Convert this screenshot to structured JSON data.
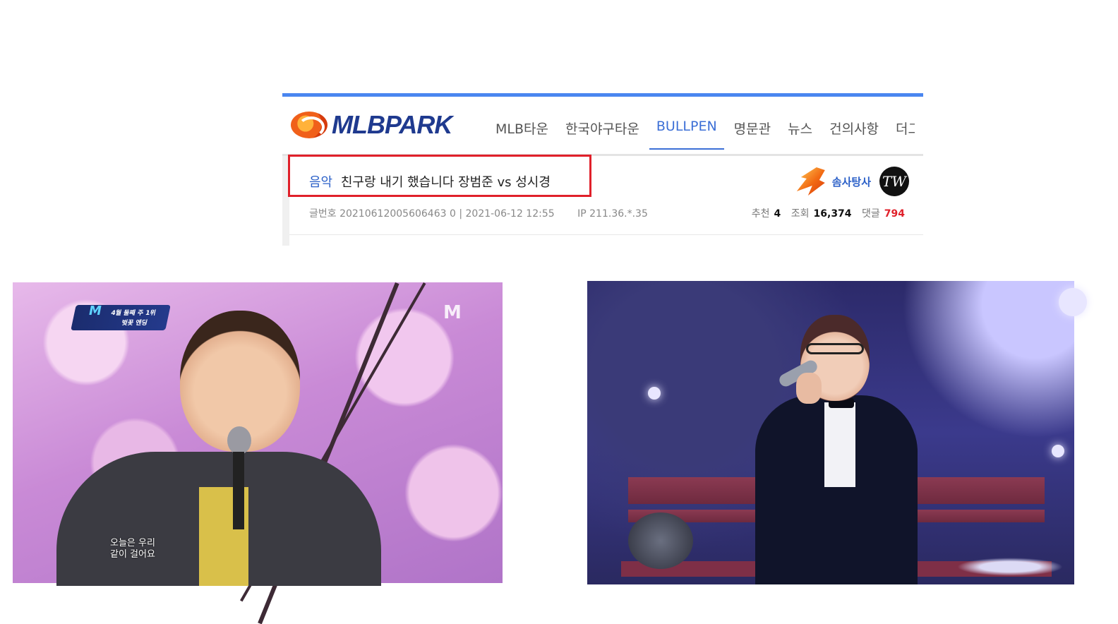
{
  "site": {
    "logo_text": "MLBPARK",
    "nav": [
      "MLB타운",
      "한국야구타운",
      "BULLPEN",
      "명문관",
      "뉴스",
      "건의사항",
      "더그아웃"
    ],
    "active_nav": "BULLPEN",
    "accent_color": "#4a86f0"
  },
  "post": {
    "category": "음악",
    "title": "친구랑 내기 했습니다 장범준 vs 성시경",
    "meta": {
      "post_number": "글번호 20210612005606463 0",
      "datetime": "2021-06-12 12:55",
      "ip": "IP 211.36.*.35"
    },
    "author": {
      "name": "솜사탕사",
      "badge_text": "TW"
    },
    "stats": {
      "recommend_label": "추천",
      "recommend": "4",
      "views_label": "조회",
      "views": "16,374",
      "comments_label": "댓글",
      "comments": "794"
    }
  },
  "photos": {
    "left": {
      "overlay_badge": "4월 둘째 주 1위",
      "overlay_sub": "벚꽃 엔딩",
      "watermark": "M",
      "subtitle_line1": "오늘은 우리",
      "subtitle_line2": "같이 걸어요"
    }
  }
}
